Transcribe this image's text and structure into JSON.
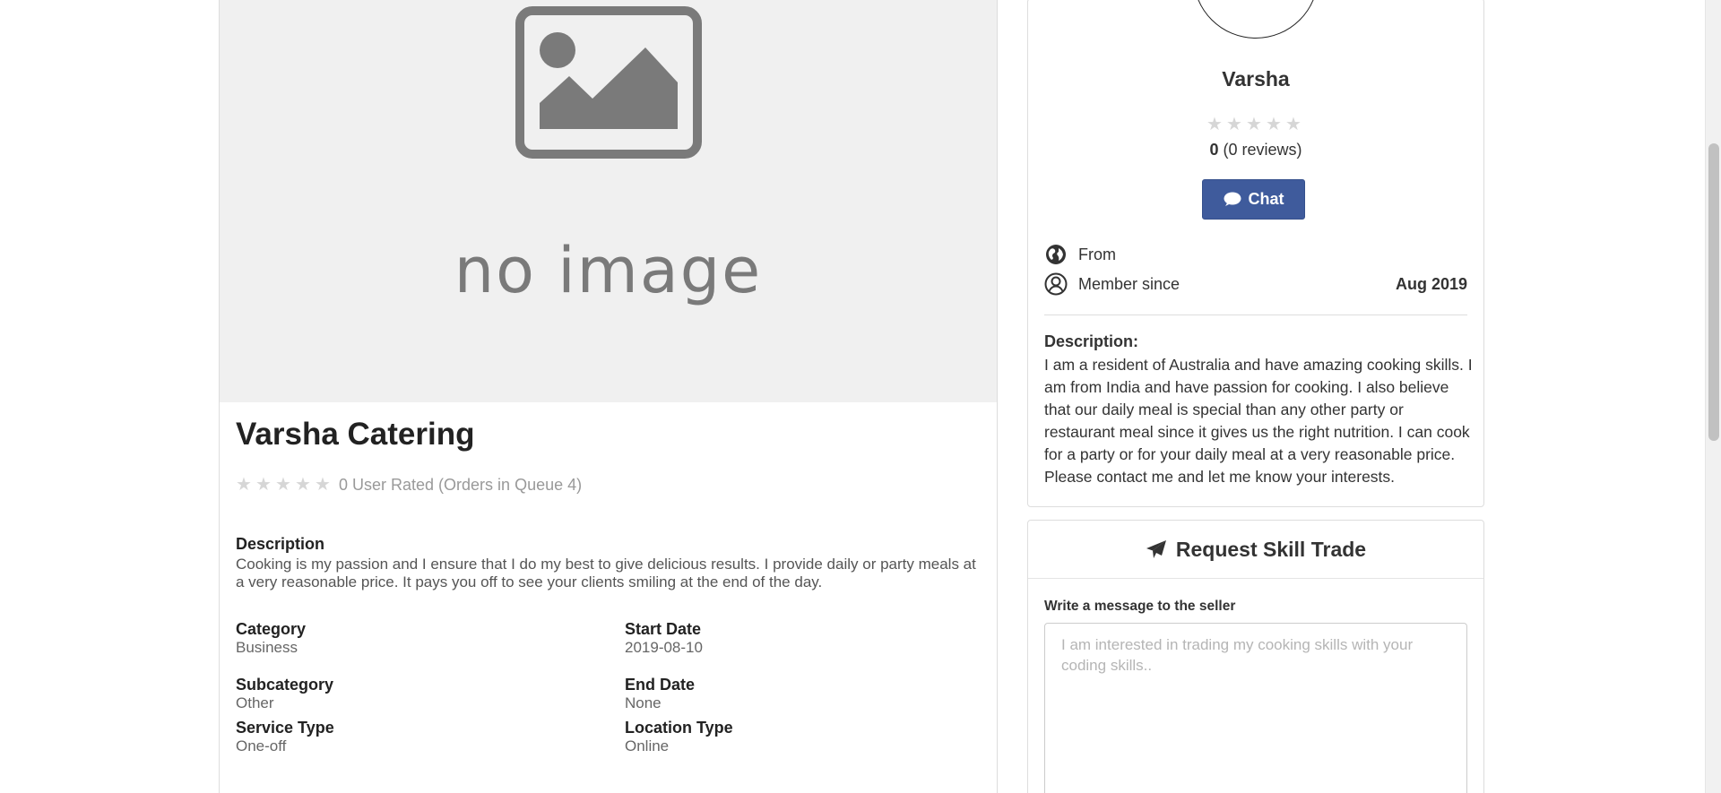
{
  "service": {
    "image_placeholder_text": "no image",
    "title": "Varsha Catering",
    "rating_text": "0 User Rated (Orders in Queue 4)",
    "rating_stars": 0,
    "description_label": "Description",
    "description_text": "Cooking is my passion and I ensure that I do my best to give delicious results. I provide daily or party meals at a very reasonable price. It pays you off to see your clients smiling at the end of the day.",
    "details": {
      "category_label": "Category",
      "category_value": "Business",
      "start_date_label": "Start Date",
      "start_date_value": "2019-08-10",
      "subcategory_label": "Subcategory",
      "subcategory_value": "Other",
      "end_date_label": "End Date",
      "end_date_value": "None",
      "service_type_label": "Service Type",
      "service_type_value": "One-off",
      "location_type_label": "Location Type",
      "location_type_value": "Online"
    }
  },
  "profile": {
    "name": "Varsha",
    "rating_stars": 0,
    "rating_value": "0",
    "review_count": "(0 reviews)",
    "chat_label": "Chat",
    "from_label": "From",
    "member_since_label": "Member since",
    "member_since_value": "Aug 2019",
    "description_label": "Description:",
    "description_text": "I am a resident of Australia and have amazing cooking skills. I am from India and have passion for cooking. I also believe that our daily meal is special than any other party or restaurant meal since it gives us the right nutrition. I can cook for a party or for your daily meal at a very reasonable price. Please contact me and let me know your interests."
  },
  "request": {
    "title": "Request Skill Trade",
    "message_label": "Write a message to the seller",
    "message_placeholder": "I am interested in trading my cooking skills with your coding skills.."
  },
  "colors": {
    "chat_button": "#3f5b9c",
    "star_empty": "#d6d6d6",
    "image_bg": "#f0f0f0"
  }
}
